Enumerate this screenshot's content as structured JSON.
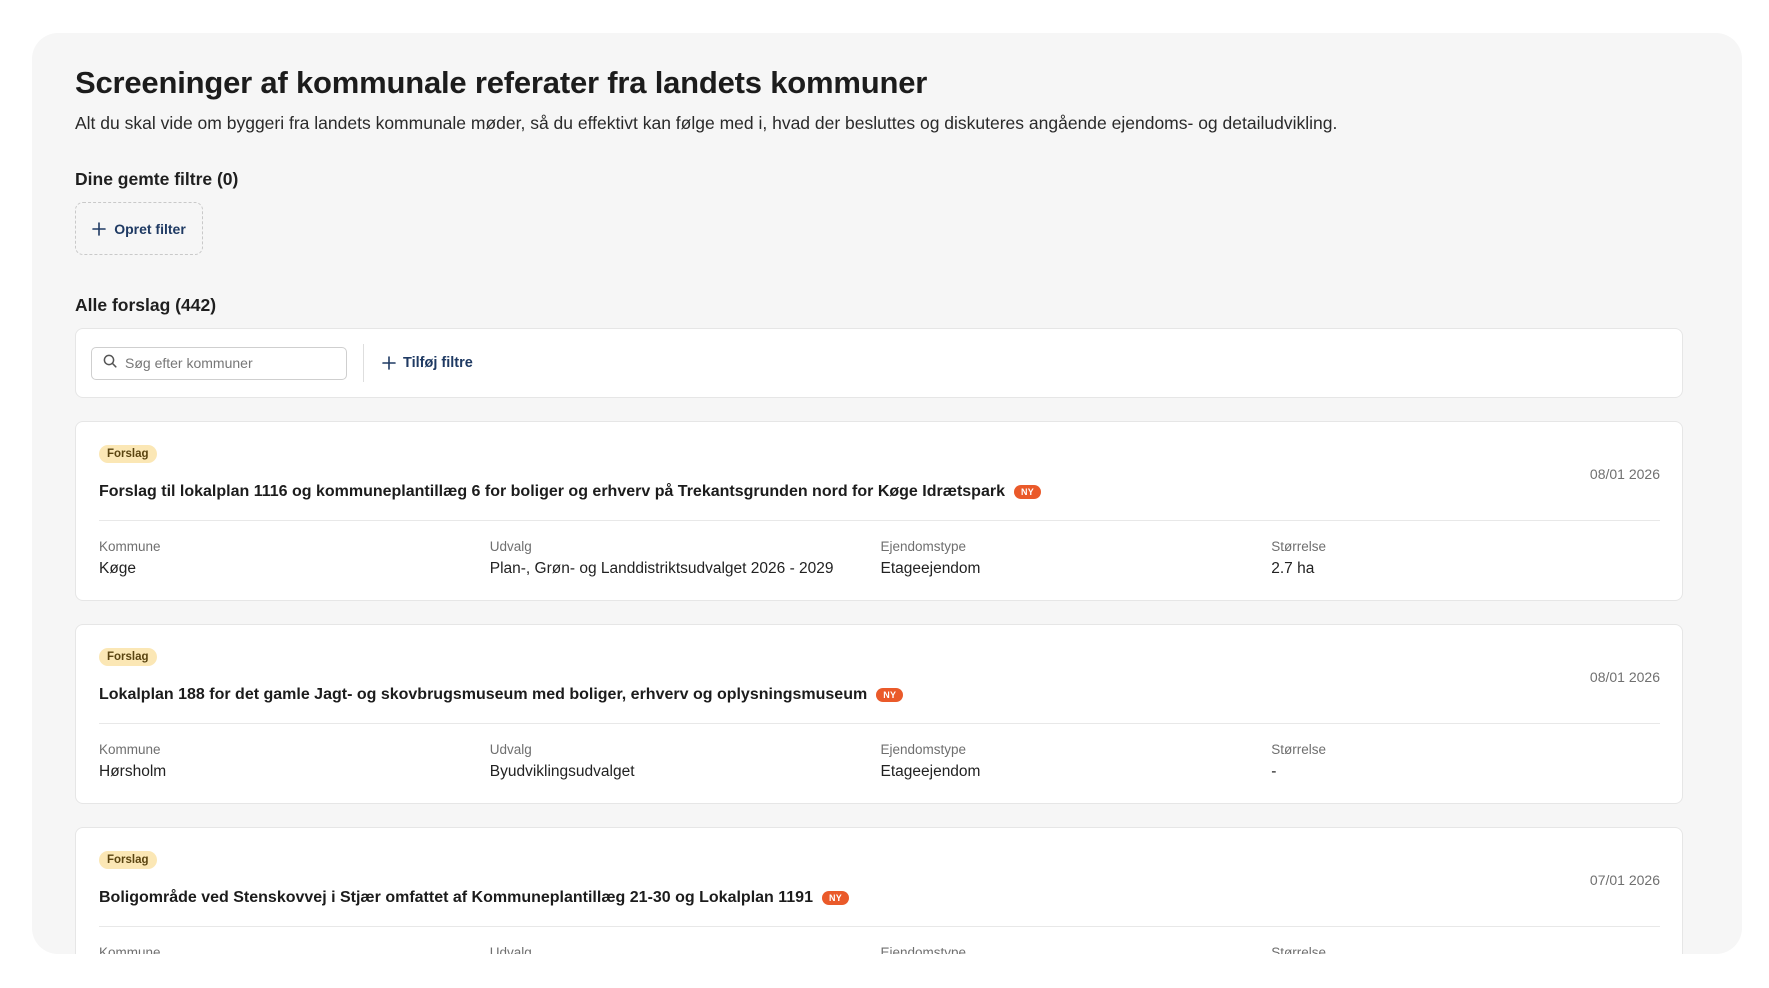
{
  "header": {
    "title": "Screeninger af kommunale referater fra landets kommuner",
    "subtitle": "Alt du skal vide om byggeri fra landets kommunale møder, så du effektivt kan følge med i, hvad der besluttes og diskuteres angående ejendoms- og detailudvikling."
  },
  "saved_filters": {
    "heading": "Dine gemte filtre (0)",
    "create_label": "Opret filter"
  },
  "proposals": {
    "heading": "Alle forslag (442)",
    "search_placeholder": "Søg efter kommuner",
    "add_filters_label": "Tilføj filtre"
  },
  "meta_labels": {
    "kommune": "Kommune",
    "udvalg": "Udvalg",
    "ejendomstype": "Ejendomstype",
    "stoerrelse": "Størrelse"
  },
  "cards": [
    {
      "badge": "Forslag",
      "title": "Forslag til lokalplan 1116 og kommuneplantillæg 6 for boliger og erhverv på Trekantsgrunden nord for Køge Idrætspark",
      "new_badge": "NY",
      "date": "08/01 2026",
      "kommune": "Køge",
      "udvalg": "Plan-, Grøn- og Landdistriktsudvalget 2026 - 2029",
      "ejendomstype": "Etageejendom",
      "stoerrelse": "2.7 ha"
    },
    {
      "badge": "Forslag",
      "title": "Lokalplan 188 for det gamle Jagt- og skovbrugsmuseum med boliger, erhverv og oplysningsmuseum",
      "new_badge": "NY",
      "date": "08/01 2026",
      "kommune": "Hørsholm",
      "udvalg": "Byudviklingsudvalget",
      "ejendomstype": "Etageejendom",
      "stoerrelse": "-"
    },
    {
      "badge": "Forslag",
      "title": "Boligområde ved Stenskovvej i Stjær omfattet af Kommuneplantillæg 21-30 og Lokalplan 1191",
      "new_badge": "NY",
      "date": "07/01 2026",
      "kommune": "",
      "udvalg": "",
      "ejendomstype": "",
      "stoerrelse": ""
    }
  ],
  "icons": {
    "search": "search-icon",
    "plus": "plus-icon"
  },
  "colors": {
    "accent_text": "#1f3a63",
    "badge_bg": "#fbe7b5",
    "new_badge_bg": "#ea5a2a"
  }
}
